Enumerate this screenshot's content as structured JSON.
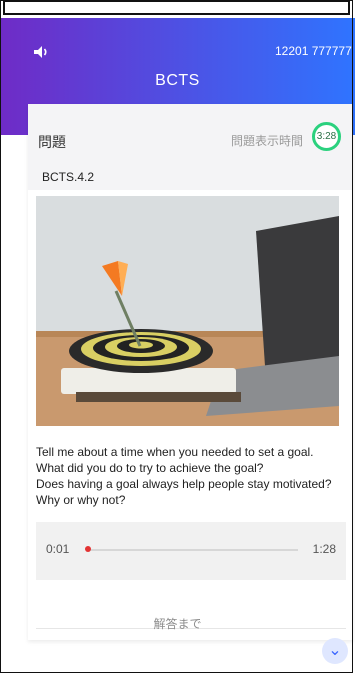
{
  "header": {
    "speaker_icon": "speaker-icon",
    "account": "12201 777777",
    "title": "BCTS"
  },
  "question": {
    "label": "問題",
    "timer_label": "問題表示時間",
    "timer_value": "3:28",
    "code": "BCTS.4.2",
    "text_lines": [
      "Tell me about a time when you needed to set a goal.",
      "What did you do to try to achieve the goal?",
      "Does having a goal always help people stay motivated?",
      "Why or why not?"
    ]
  },
  "audio": {
    "current": "0:01",
    "duration": "1:28",
    "progress": 0.01,
    "accent": "#e33333"
  },
  "footer": {
    "label": "解答まで",
    "expand_icon": "chevron-down-icon"
  },
  "colors": {
    "header_start": "#6f2bc6",
    "header_end": "#2f74ff",
    "timer_ring": "#2bd17e",
    "expand_bg": "#dfe7ff"
  }
}
